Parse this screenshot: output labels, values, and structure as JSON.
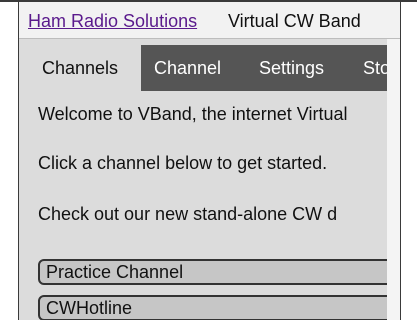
{
  "header": {
    "link_text": "Ham Radio Solutions",
    "title_rest": " Virtual CW Band"
  },
  "tabs": [
    {
      "label": "Channels",
      "active": true
    },
    {
      "label": "Channel",
      "active": false
    },
    {
      "label": "Settings",
      "active": false
    },
    {
      "label": "Sto",
      "active": false
    }
  ],
  "intro": {
    "welcome": "Welcome to VBand, the internet Virtual",
    "instruction": "Click a channel below to get started.",
    "promo": "Check out our new stand-alone CW d"
  },
  "channels": [
    {
      "name": "Practice Channel"
    },
    {
      "name": "CWHotline"
    }
  ],
  "colors": {
    "link": "#5a1a8c",
    "tabbar": "#555555",
    "panel": "#dcdcdc",
    "channel_button": "#c6c6c6"
  }
}
